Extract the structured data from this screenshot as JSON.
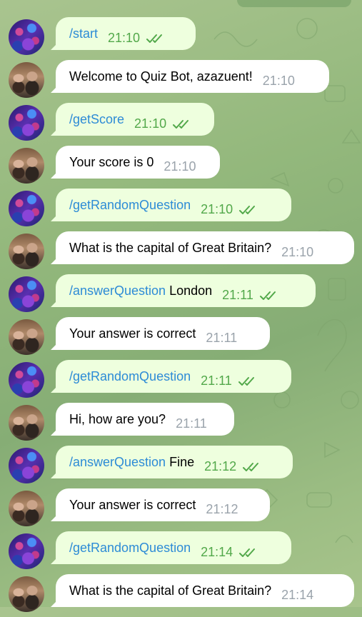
{
  "chat": {
    "messages": [
      {
        "sender": "user",
        "command": "/start",
        "text": "",
        "time": "21:10",
        "read": true
      },
      {
        "sender": "bot",
        "command": "",
        "text": "Welcome to Quiz Bot, azazuent!",
        "time": "21:10"
      },
      {
        "sender": "user",
        "command": "/getScore",
        "text": "",
        "time": "21:10",
        "read": true
      },
      {
        "sender": "bot",
        "command": "",
        "text": "Your score is 0",
        "time": "21:10"
      },
      {
        "sender": "user",
        "command": "/getRandomQuestion",
        "text": "",
        "time": "21:10",
        "read": true
      },
      {
        "sender": "bot",
        "command": "",
        "text": "What is the capital of Great Britain?",
        "time": "21:10"
      },
      {
        "sender": "user",
        "command": "/answerQuestion",
        "text": " London",
        "time": "21:11",
        "read": true
      },
      {
        "sender": "bot",
        "command": "",
        "text": "Your answer is correct",
        "time": "21:11"
      },
      {
        "sender": "user",
        "command": "/getRandomQuestion",
        "text": "",
        "time": "21:11",
        "read": true
      },
      {
        "sender": "bot",
        "command": "",
        "text": "Hi, how are you?",
        "time": "21:11"
      },
      {
        "sender": "user",
        "command": "/answerQuestion",
        "text": " Fine",
        "time": "21:12",
        "read": true
      },
      {
        "sender": "bot",
        "command": "",
        "text": "Your answer is correct",
        "time": "21:12"
      },
      {
        "sender": "user",
        "command": "/getRandomQuestion",
        "text": "",
        "time": "21:14",
        "read": true
      },
      {
        "sender": "bot",
        "command": "",
        "text": "What is the capital of Great Britain?",
        "time": "21:14"
      }
    ]
  },
  "colors": {
    "outgoing_bubble": "#eeffde",
    "incoming_bubble": "#ffffff",
    "command_link": "#2d8bd6",
    "outgoing_time": "#52a84a",
    "incoming_time": "#9aa3ab",
    "wallpaper": "#93b87c"
  },
  "icons": {
    "read_receipt": "double-check-icon",
    "user_avatar": "user-avatar",
    "bot_avatar": "bot-avatar"
  }
}
